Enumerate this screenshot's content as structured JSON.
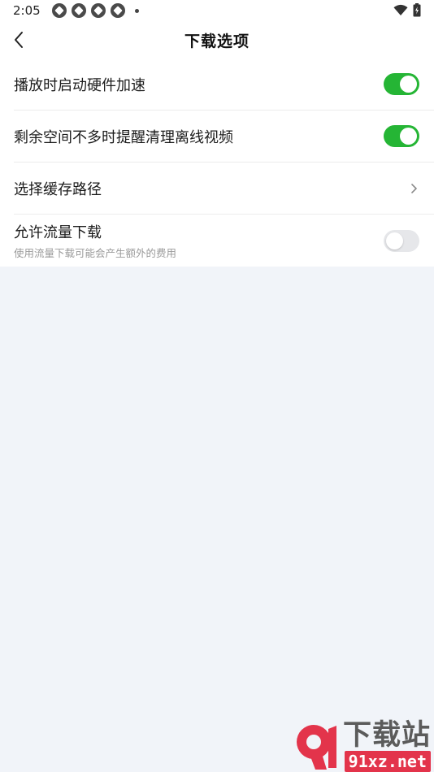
{
  "status_bar": {
    "time": "2:05",
    "notification_icons": [
      "app-notification-icon",
      "app-notification-icon",
      "app-notification-icon",
      "app-notification-icon"
    ],
    "right_icons": [
      "wifi-icon",
      "battery-icon"
    ]
  },
  "header": {
    "title": "下载选项",
    "back_icon": "chevron-left-icon"
  },
  "settings": {
    "hw_accel": {
      "label": "播放时启动硬件加速",
      "enabled": true
    },
    "auto_clean": {
      "label": "剩余空间不多时提醒清理离线视频",
      "enabled": true
    },
    "cache_path": {
      "label": "选择缓存路径",
      "icon": "chevron-right-icon"
    },
    "data_download": {
      "label": "允许流量下载",
      "sublabel": "使用流量下载可能会产生额外的费用",
      "enabled": false
    }
  },
  "colors": {
    "toggle_on": "#25b535",
    "toggle_off": "#e6e7ea",
    "page_background": "#f1f4f9"
  },
  "watermark": {
    "logo_text": "9",
    "title": "下载站",
    "url": "91xz.net"
  }
}
